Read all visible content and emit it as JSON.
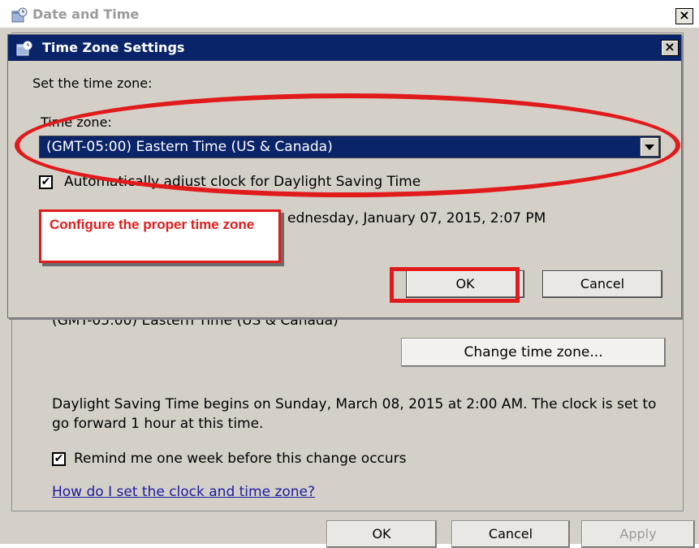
{
  "outer_window": {
    "title": "Date and Time",
    "close_glyph": "×",
    "partial_time_zone": "(GMT-05:00) Eastern Time (US & Canada)",
    "change_time_zone_label": "Change time zone...",
    "dst_notice": "Daylight Saving Time begins on Sunday, March 08, 2015 at 2:00 AM. The clock is set to go forward 1 hour at this time.",
    "remind_label": "Remind me one week before this change occurs",
    "remind_checked": true,
    "help_link": "How do I set the clock and time zone?",
    "buttons": {
      "ok": "OK",
      "cancel": "Cancel",
      "apply": "Apply"
    }
  },
  "dialog": {
    "title": "Time Zone Settings",
    "close_glyph": "×",
    "set_label": "Set the time zone:",
    "time_zone_label": "Time zone:",
    "selected_time_zone": "(GMT-05:00) Eastern Time (US & Canada)",
    "auto_dst_label": "Automatically adjust clock for Daylight Saving Time",
    "auto_dst_checked": true,
    "current_date_partial": "ednesday, January 07, 2015, 2:07 PM",
    "ok_label": "OK",
    "cancel_label": "Cancel"
  },
  "annotation": {
    "callout_text": "Configure the proper time zone",
    "accent_color": "#e11b1b"
  },
  "colors": {
    "window_bg": "#d4d0c8",
    "title_active": "#0a246a",
    "link": "#1a1aa0"
  }
}
